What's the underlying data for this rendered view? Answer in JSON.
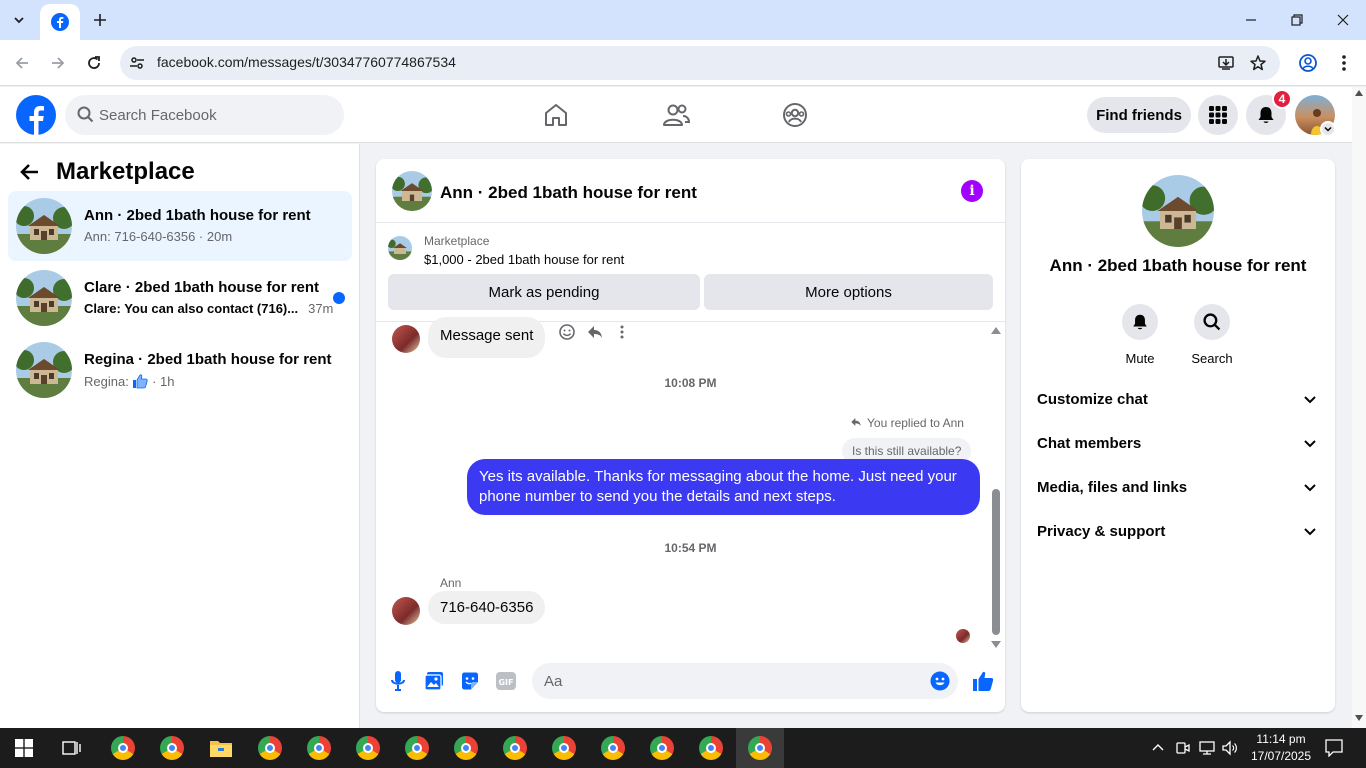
{
  "browser": {
    "url": "facebook.com/messages/t/30347760774867534"
  },
  "facebook": {
    "search_placeholder": "Search Facebook",
    "find_friends_label": "Find friends",
    "notifications_count": "4"
  },
  "left_panel": {
    "title": "Marketplace",
    "conversations": [
      {
        "title": "Ann · 2bed 1bath house for rent",
        "preview": "Ann: 716-640-6356 · 20m",
        "active": true,
        "unread": false
      },
      {
        "title": "Clare · 2bed 1bath house for rent",
        "preview": "Clare: You can also contact (716)...",
        "time": "37m",
        "active": false,
        "unread": true
      },
      {
        "title": "Regina · 2bed 1bath house for rent",
        "preview_prefix": "Regina:",
        "preview_suffix": "· 1h",
        "active": false,
        "unread": false
      }
    ]
  },
  "chat": {
    "title": "Ann · 2bed 1bath house for rent",
    "marketplace_label": "Marketplace",
    "listing": "$1,000 - 2bed 1bath house for rent",
    "mark_pending_label": "Mark as pending",
    "more_options_label": "More options",
    "messages": {
      "sent_note": "Message sent",
      "timestamp_1": "10:08 PM",
      "reply_note": "You replied to Ann",
      "quoted": "Is this still available?",
      "outgoing": "Yes its available. Thanks for messaging about the home. Just need your phone number to send you the details and next steps.",
      "timestamp_2": "10:54 PM",
      "sender": "Ann",
      "incoming": "716-640-6356"
    },
    "composer_placeholder": "Aa"
  },
  "right_panel": {
    "name": "Ann · 2bed 1bath house for rent",
    "mute_label": "Mute",
    "search_label": "Search",
    "sections": [
      "Customize chat",
      "Chat members",
      "Media, files and links",
      "Privacy & support"
    ]
  },
  "taskbar": {
    "time": "11:14 pm",
    "date": "17/07/2025"
  },
  "colors": {
    "fb_blue": "#0866ff",
    "outgoing_bubble": "#3c39f2",
    "info_purple": "#a200ff",
    "badge_red": "#e41e3f"
  }
}
